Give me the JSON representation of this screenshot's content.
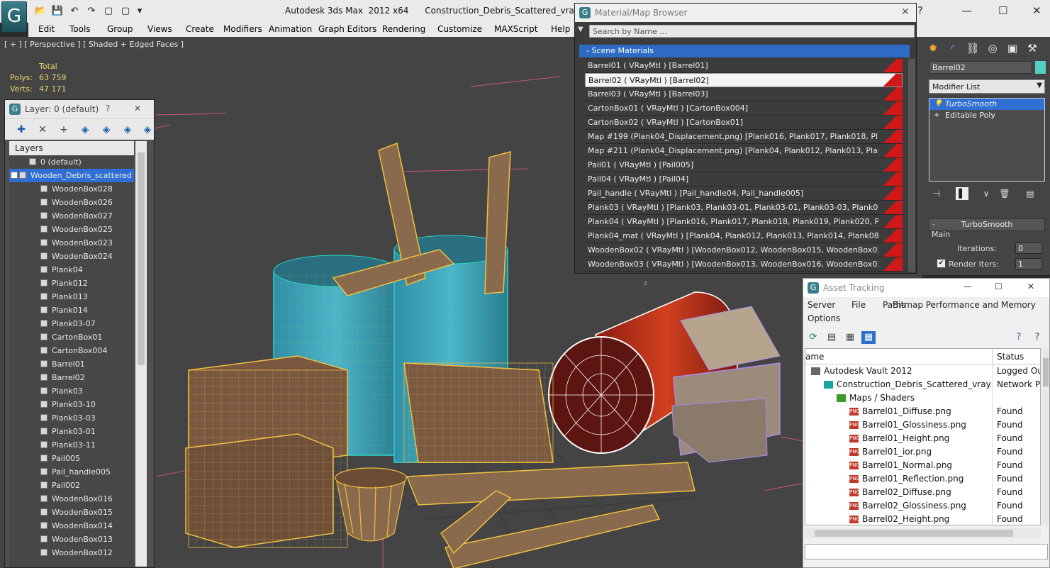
{
  "app": {
    "title": "Autodesk 3ds Max  2012 x64",
    "file": "Construction_Debris_Scattered_vray.max",
    "logo_glyph": "G"
  },
  "quick_access": [
    "📂",
    "💾",
    "↶",
    "↷",
    "▢",
    "▢",
    "▾"
  ],
  "menu": [
    "Edit",
    "Tools",
    "Group",
    "Views",
    "Create",
    "Modifiers",
    "Animation",
    "Graph Editors",
    "Rendering",
    "Customize",
    "MAXScript",
    "Help"
  ],
  "viewport": {
    "label": "[ + ] [ Perspective ] [ Shaded + Edged Faces ]",
    "stats_header": "Total",
    "polys_label": "Polys:",
    "polys_value": "63 759",
    "verts_label": "Verts:",
    "verts_value": "47 171",
    "axis_label": "z"
  },
  "layer_explorer": {
    "title": "Layer: 0 (default)",
    "help": "?",
    "close": "✕",
    "header": "Layers",
    "rows": [
      {
        "label": "0 (default)",
        "indent": 1,
        "selected": false
      },
      {
        "label": "Wooden_Debris_scattered",
        "indent": 0,
        "selected": true
      },
      {
        "label": "WoodenBox028",
        "indent": 2
      },
      {
        "label": "WoodenBox026",
        "indent": 2
      },
      {
        "label": "WoodenBox027",
        "indent": 2
      },
      {
        "label": "WoodenBox025",
        "indent": 2
      },
      {
        "label": "WoodenBox023",
        "indent": 2
      },
      {
        "label": "WoodenBox024",
        "indent": 2
      },
      {
        "label": "Plank04",
        "indent": 2
      },
      {
        "label": "Plank012",
        "indent": 2
      },
      {
        "label": "Plank013",
        "indent": 2
      },
      {
        "label": "Plank014",
        "indent": 2
      },
      {
        "label": "Plank03-07",
        "indent": 2
      },
      {
        "label": "CartonBox01",
        "indent": 2
      },
      {
        "label": "CartonBox004",
        "indent": 2
      },
      {
        "label": "Barrel01",
        "indent": 2
      },
      {
        "label": "Barrel02",
        "indent": 2
      },
      {
        "label": "Plank03",
        "indent": 2
      },
      {
        "label": "Plank03-10",
        "indent": 2
      },
      {
        "label": "Plank03-03",
        "indent": 2
      },
      {
        "label": "Plank03-01",
        "indent": 2
      },
      {
        "label": "Plank03-11",
        "indent": 2
      },
      {
        "label": "Pail005",
        "indent": 2
      },
      {
        "label": "Pail_handle005",
        "indent": 2
      },
      {
        "label": "Pail002",
        "indent": 2
      },
      {
        "label": "WoodenBox016",
        "indent": 2
      },
      {
        "label": "WoodenBox015",
        "indent": 2
      },
      {
        "label": "WoodenBox014",
        "indent": 2
      },
      {
        "label": "WoodenBox013",
        "indent": 2
      },
      {
        "label": "WoodenBox012",
        "indent": 2
      }
    ]
  },
  "material_browser": {
    "title": "Material/Map Browser",
    "close": "✕",
    "search_placeholder": "Search by Name ...",
    "group": "- Scene Materials",
    "rows": [
      {
        "label": "Barrel01  ( VRayMtl )  [Barrel01]",
        "selected": false
      },
      {
        "label": "Barrel02  ( VRayMtl )  [Barrel02]",
        "selected": true
      },
      {
        "label": "Barrel03  ( VRayMtl )  [Barrel03]",
        "selected": false
      },
      {
        "label": "CartonBox01  ( VRayMtl )  [CartonBox004]",
        "selected": false
      },
      {
        "label": "CartonBox02  ( VRayMtl )  [CartonBox01]",
        "selected": false
      },
      {
        "label": "Map #199 (Plank04_Displacement.png)  [Plank016, Plank017, Plank018, Plank019, Pla...",
        "selected": false
      },
      {
        "label": "Map #211 (Plank04_Displacement.png)  [Plank04, Plank012, Plank013, Plank014, Pla...",
        "selected": false
      },
      {
        "label": "Pail01  ( VRayMtl )  [Pail005]",
        "selected": false
      },
      {
        "label": "Pail04  ( VRayMtl )  [Pail04]",
        "selected": false
      },
      {
        "label": "Pail_handle  ( VRayMtl )  [Pail_handle04, Pail_handle005]",
        "selected": false
      },
      {
        "label": "Plank03  ( VRayMtl )  [Plank03, Plank03-01, Plank03-01, Plank03-03, Plank03-03, Plan...",
        "selected": false
      },
      {
        "label": "Plank04  ( VRayMtl )  [Plank016, Plank017, Plank018, Plank019, Plank020, Plank021]",
        "selected": false
      },
      {
        "label": "Plank04_mat  ( VRayMtl )  [Plank04, Plank012, Plank013, Plank014, Plank080]",
        "selected": false
      },
      {
        "label": "WoodenBox02  ( VRayMtl )  [WoodenBox012, WoodenBox015, WoodenBox023, Wood...",
        "selected": false
      },
      {
        "label": "WoodenBox03  ( VRayMtl )  [WoodenBox013, WoodenBox016, WoodenBox025, Wood...",
        "selected": false
      }
    ]
  },
  "command_panel": {
    "object_name": "Barrel02",
    "object_color": "#54d0c0",
    "modifier_list": "Modifier List",
    "stack": [
      {
        "label": "TurboSmooth",
        "selected": true
      },
      {
        "label": "Editable Poly",
        "selected": false
      }
    ],
    "rollout_title": "TurboSmooth",
    "rollout_minus": "-",
    "main_label": "Main",
    "iterations_label": "Iterations:",
    "iterations_value": "0",
    "render_iters_label": "Render Iters:",
    "render_iters_value": "1",
    "render_iters_checked": true
  },
  "asset_tracking": {
    "title": "Asset Tracking",
    "minimize": "—",
    "maximize": "☐",
    "close": "✕",
    "menu": [
      "Server",
      "File",
      "Paths",
      "Bitmap Performance and Memory",
      "Options"
    ],
    "col_name": "ame",
    "col_status": "Status",
    "rows": [
      {
        "name": "Autodesk Vault 2012",
        "status": "Logged Out",
        "indent": 0,
        "icon": "vault"
      },
      {
        "name": "Construction_Debris_Scattered_vray.max",
        "status": "Network Path",
        "indent": 1,
        "icon": "max"
      },
      {
        "name": "Maps / Shaders",
        "status": "",
        "indent": 2,
        "icon": "maps"
      },
      {
        "name": "Barrel01_Diffuse.png",
        "status": "Found",
        "indent": 3,
        "icon": "png"
      },
      {
        "name": "Barrel01_Glossiness.png",
        "status": "Found",
        "indent": 3,
        "icon": "png"
      },
      {
        "name": "Barrel01_Height.png",
        "status": "Found",
        "indent": 3,
        "icon": "png"
      },
      {
        "name": "Barrel01_ior.png",
        "status": "Found",
        "indent": 3,
        "icon": "png"
      },
      {
        "name": "Barrel01_Normal.png",
        "status": "Found",
        "indent": 3,
        "icon": "png"
      },
      {
        "name": "Barrel01_Reflection.png",
        "status": "Found",
        "indent": 3,
        "icon": "png"
      },
      {
        "name": "Barrel02_Diffuse.png",
        "status": "Found",
        "indent": 3,
        "icon": "png"
      },
      {
        "name": "Barrel02_Glossiness.png",
        "status": "Found",
        "indent": 3,
        "icon": "png"
      },
      {
        "name": "Barrel02_Height.png",
        "status": "Found",
        "indent": 3,
        "icon": "png"
      }
    ],
    "png_badge": "PNG"
  }
}
